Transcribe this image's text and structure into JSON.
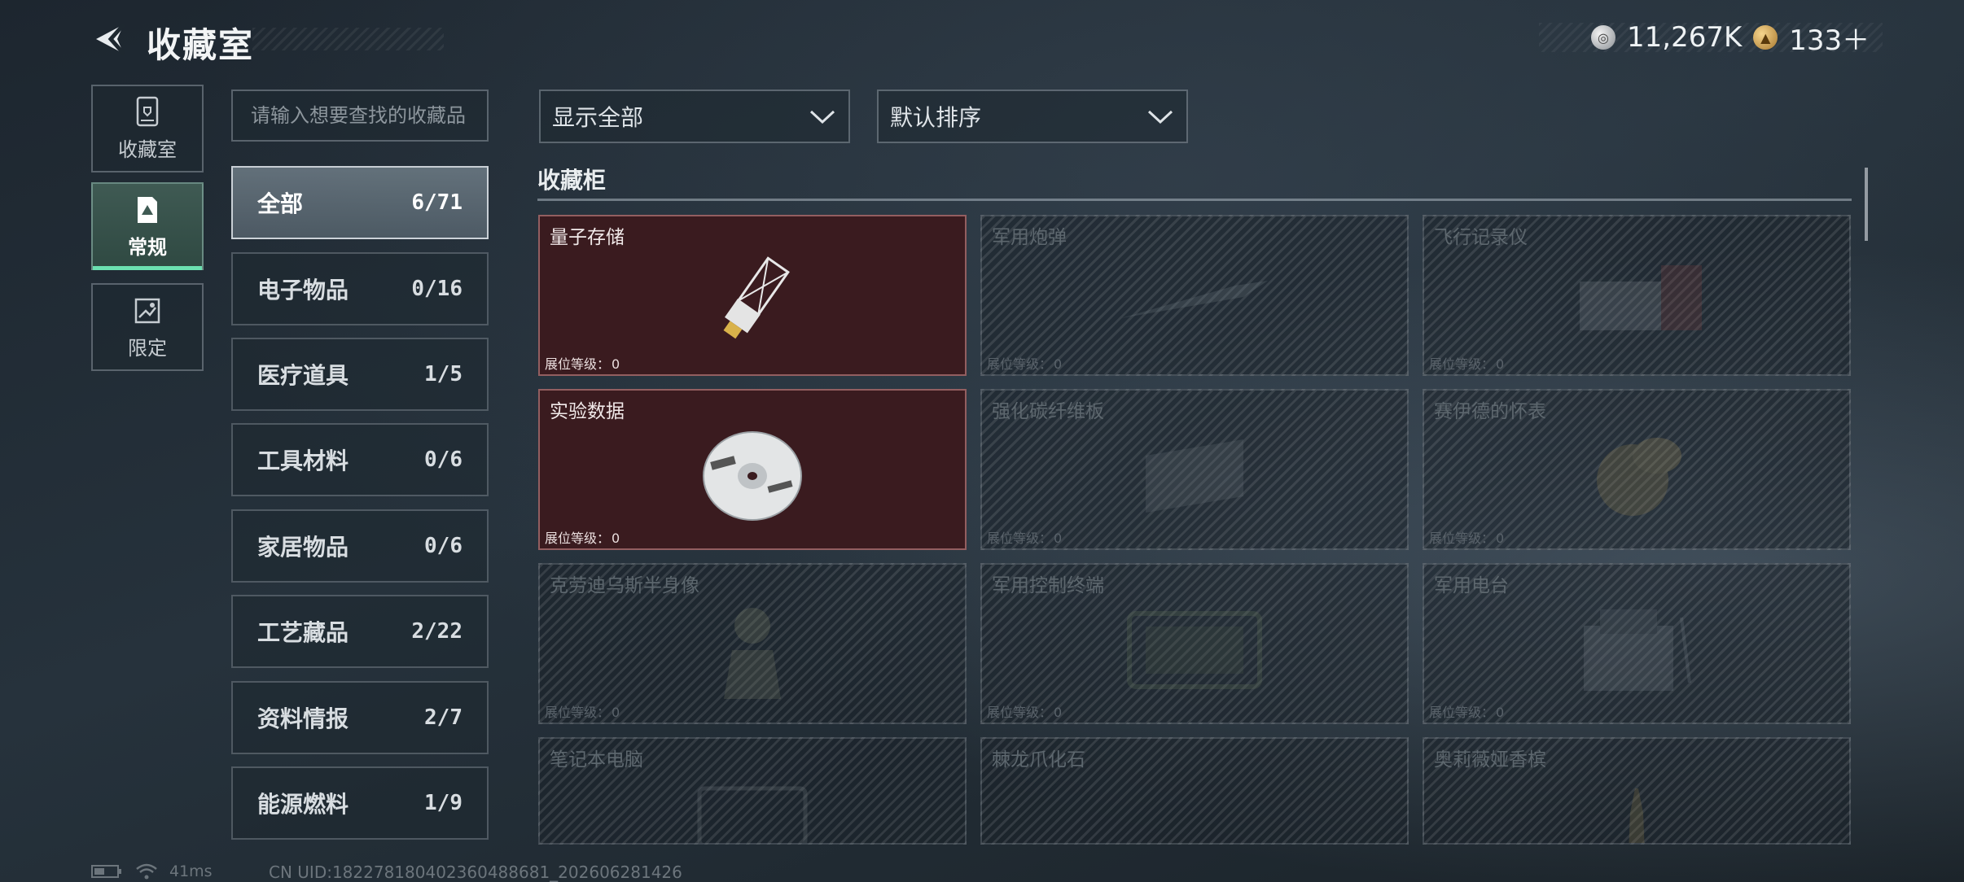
{
  "header": {
    "title": "收藏室",
    "currency": [
      {
        "icon": "silver-coin-icon",
        "value": "11,267K"
      },
      {
        "icon": "gold-coin-icon",
        "value": "133＋"
      }
    ]
  },
  "nav": [
    {
      "label": "收藏室",
      "icon": "trophy-case-icon",
      "active": false
    },
    {
      "label": "常规",
      "icon": "regular-collection-icon",
      "active": true
    },
    {
      "label": "限定",
      "icon": "limited-collection-icon",
      "active": false
    }
  ],
  "search": {
    "placeholder": "请输入想要查找的收藏品",
    "value": ""
  },
  "categories": [
    {
      "name": "全部",
      "count": "6/71",
      "active": true
    },
    {
      "name": "电子物品",
      "count": "0/16"
    },
    {
      "name": "医疗道具",
      "count": "1/5"
    },
    {
      "name": "工具材料",
      "count": "0/6"
    },
    {
      "name": "家居物品",
      "count": "0/6"
    },
    {
      "name": "工艺藏品",
      "count": "2/22"
    },
    {
      "name": "资料情报",
      "count": "2/7"
    },
    {
      "name": "能源燃料",
      "count": "1/9"
    }
  ],
  "filters": {
    "display": {
      "value": "显示全部",
      "icon": "chevron-down-icon"
    },
    "sort": {
      "value": "默认排序",
      "icon": "chevron-down-icon"
    }
  },
  "section": {
    "title": "收藏柜"
  },
  "level_label": "展位等级：",
  "items": [
    {
      "name": "量子存储",
      "level": "0",
      "unlocked": true,
      "art": "usb-drive"
    },
    {
      "name": "军用炮弹",
      "level": "0",
      "unlocked": false,
      "art": "shell"
    },
    {
      "name": "飞行记录仪",
      "level": "0",
      "unlocked": false,
      "art": "box"
    },
    {
      "name": "实验数据",
      "level": "0",
      "unlocked": true,
      "art": "disc"
    },
    {
      "name": "强化碳纤维板",
      "level": "0",
      "unlocked": false,
      "art": "panel"
    },
    {
      "name": "赛伊德的怀表",
      "level": "0",
      "unlocked": false,
      "art": "watch"
    },
    {
      "name": "克劳迪乌斯半身像",
      "level": "0",
      "unlocked": false,
      "art": "bust"
    },
    {
      "name": "军用控制终端",
      "level": "0",
      "unlocked": false,
      "art": "terminal"
    },
    {
      "name": "军用电台",
      "level": "0",
      "unlocked": false,
      "art": "radio"
    },
    {
      "name": "笔记本电脑",
      "level": "",
      "unlocked": false,
      "art": "laptop"
    },
    {
      "name": "棘龙爪化石",
      "level": "",
      "unlocked": false,
      "art": "claw"
    },
    {
      "name": "奥莉薇娅香槟",
      "level": "",
      "unlocked": false,
      "art": "bottle"
    }
  ],
  "status": {
    "ping": "41ms",
    "uid": "CN UID:18227818040236048868‍1_202606281426"
  }
}
